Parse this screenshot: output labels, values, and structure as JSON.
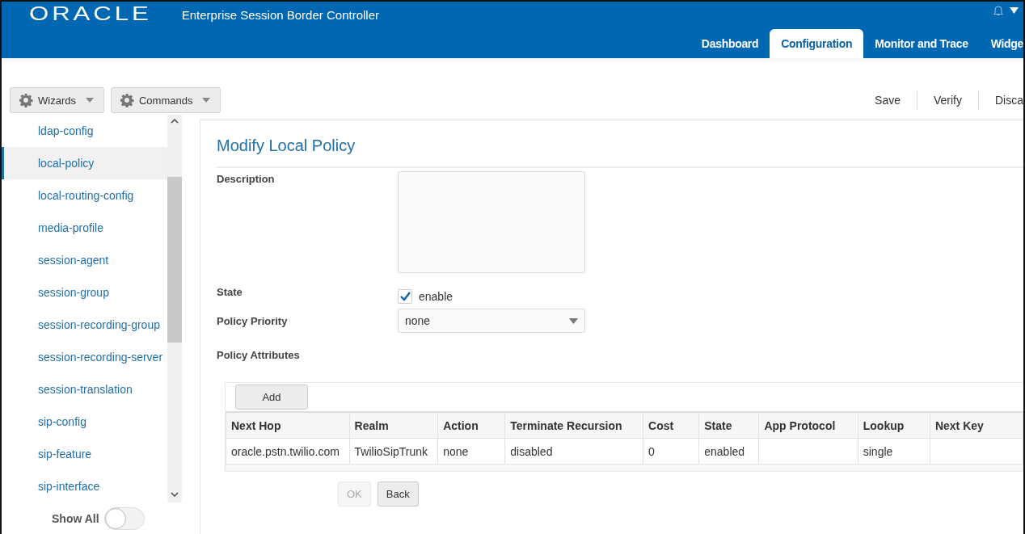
{
  "header": {
    "logo": "ORACLE",
    "title": "Enterprise Session Border Controller"
  },
  "tabs": [
    {
      "label": "Dashboard",
      "selected": false
    },
    {
      "label": "Configuration",
      "selected": true
    },
    {
      "label": "Monitor and Trace",
      "selected": false
    },
    {
      "label": "Widge",
      "selected": false
    }
  ],
  "toolbar": {
    "menus": [
      "Wizards",
      "Commands"
    ],
    "actions": [
      "Save",
      "Verify",
      "Disca"
    ]
  },
  "sidebar": {
    "items": [
      {
        "label": "ldap-config",
        "selected": false
      },
      {
        "label": "local-policy",
        "selected": true
      },
      {
        "label": "local-routing-config",
        "selected": false
      },
      {
        "label": "media-profile",
        "selected": false
      },
      {
        "label": "session-agent",
        "selected": false
      },
      {
        "label": "session-group",
        "selected": false
      },
      {
        "label": "session-recording-group",
        "selected": false
      },
      {
        "label": "session-recording-server",
        "selected": false
      },
      {
        "label": "session-translation",
        "selected": false
      },
      {
        "label": "sip-config",
        "selected": false
      },
      {
        "label": "sip-feature",
        "selected": false
      },
      {
        "label": "sip-interface",
        "selected": false
      }
    ],
    "show_all": {
      "label": "Show All",
      "on": false
    }
  },
  "form": {
    "title": "Modify Local Policy",
    "description": {
      "label": "Description"
    },
    "state": {
      "label": "State",
      "checked": true,
      "option": "enable"
    },
    "priority": {
      "label": "Policy Priority",
      "value": "none"
    },
    "attributes": {
      "label": "Policy Attributes"
    }
  },
  "table": {
    "add": "Add",
    "columns": [
      "Next Hop",
      "Realm",
      "Action",
      "Terminate Recursion",
      "Cost",
      "State",
      "App Protocol",
      "Lookup",
      "Next Key"
    ],
    "rows": [
      [
        "oracle.pstn.twilio.com",
        "TwilioSipTrunk",
        "none",
        "disabled",
        "0",
        "enabled",
        "",
        "single",
        ""
      ]
    ]
  },
  "buttons": [
    {
      "label": "OK",
      "disabled": true
    },
    {
      "label": "Back",
      "disabled": false
    }
  ]
}
